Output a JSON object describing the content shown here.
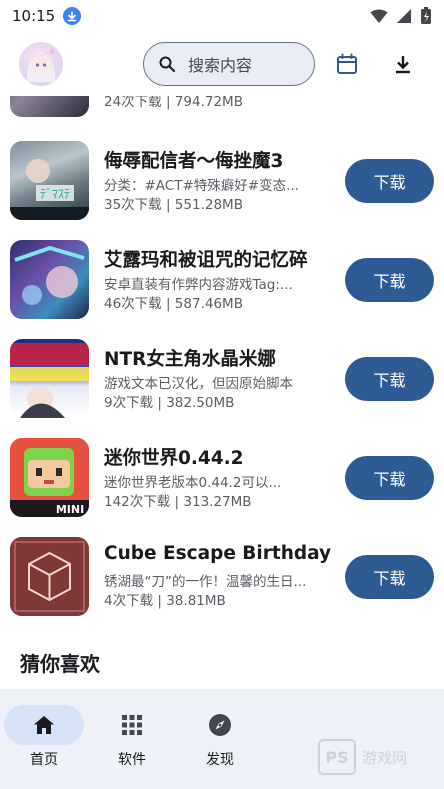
{
  "status_bar": {
    "time": "10:15"
  },
  "app_bar": {
    "search_placeholder": "搜索内容"
  },
  "items": [
    {
      "title": "",
      "desc": "",
      "meta": "24次下载 | 794.72MB",
      "download_label": ""
    },
    {
      "title": "侮辱配信者～侮挫魔3",
      "desc": "分类：#ACT#特殊癖好#变态...",
      "meta": "35次下载 | 551.28MB",
      "download_label": "下载"
    },
    {
      "title": "艾露玛和被诅咒的记忆碎",
      "desc": "安卓直装有作弊内容游戏Tag:...",
      "meta": "46次下载 | 587.46MB",
      "download_label": "下载"
    },
    {
      "title": "NTR女主角水晶米娜",
      "desc": "游戏文本已汉化，但因原始脚本",
      "meta": "9次下载 | 382.50MB",
      "download_label": "下载"
    },
    {
      "title": "迷你世界0.44.2",
      "desc": "迷你世界老版本0.44.2可以...",
      "meta": "142次下载 | 313.27MB",
      "download_label": "下载"
    },
    {
      "title": "Cube Escape Birthday",
      "desc": "锈湖最“刀”的一作！温馨的生日...",
      "meta": "4次下载 | 38.81MB",
      "download_label": "下载"
    }
  ],
  "section": {
    "title": "猜你喜欢"
  },
  "bottom_nav": [
    {
      "label": "首页",
      "icon": "home-icon",
      "active": true
    },
    {
      "label": "软件",
      "icon": "grid-icon",
      "active": false
    },
    {
      "label": "发现",
      "icon": "compass-icon",
      "active": false
    }
  ],
  "watermark": {
    "logo": "PS",
    "text": "游戏网"
  },
  "colors": {
    "primary": "#2f5b94",
    "nav_bg": "#eef1f8",
    "active_pill": "#d6e3f7",
    "search_bg": "#e9edf6"
  }
}
